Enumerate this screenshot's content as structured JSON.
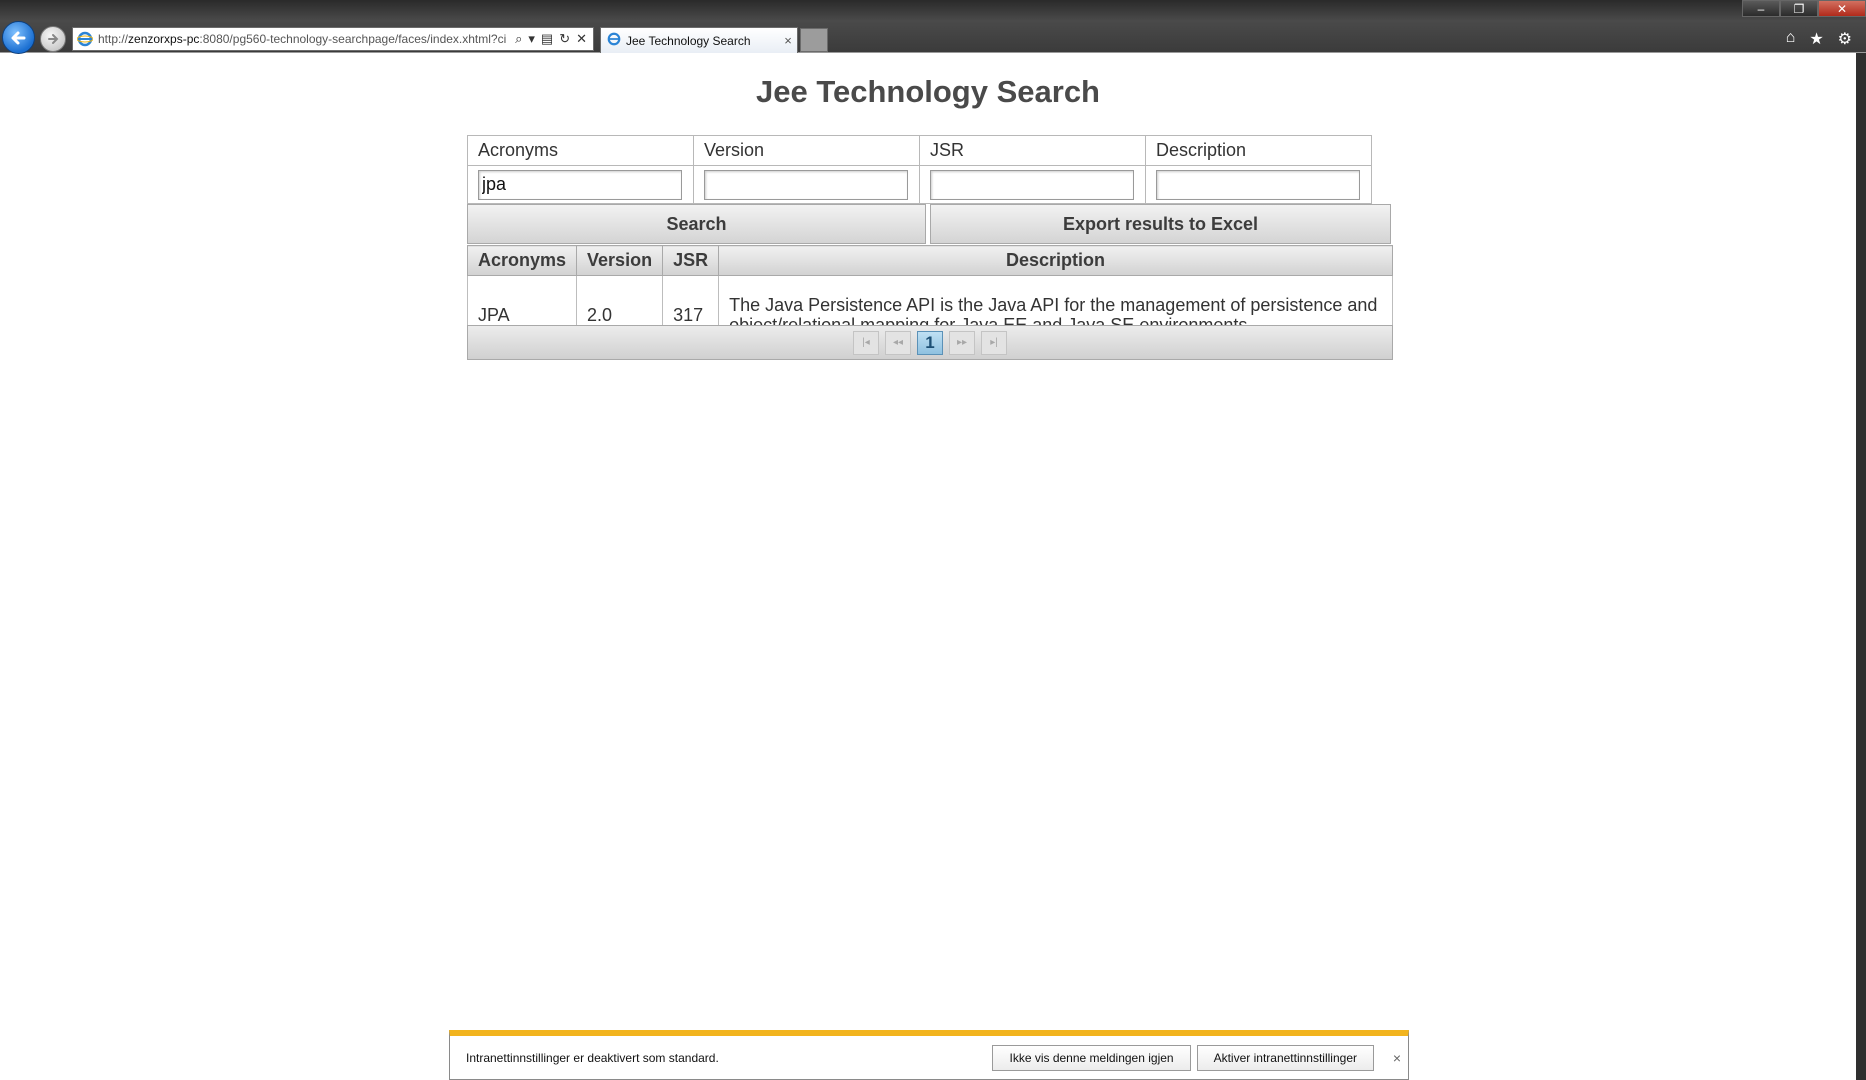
{
  "browser": {
    "url_prefix": "http://",
    "url_host": "zenzorxps-pc",
    "url_rest": ":8080/pg560-technology-searchpage/faces/index.xhtml?ci",
    "tab_title": "Jee Technology Search",
    "tab_close": "×",
    "window_buttons": {
      "minimize": "–",
      "restore": "❐",
      "close": "✕"
    }
  },
  "page": {
    "title": "Jee Technology Search"
  },
  "filters": {
    "labels": [
      "Acronyms",
      "Version",
      "JSR",
      "Description"
    ],
    "values": [
      "jpa",
      "",
      "",
      ""
    ]
  },
  "buttons": {
    "search": "Search",
    "export": "Export results to Excel"
  },
  "results": {
    "headers": [
      "Acronyms",
      "Version",
      "JSR",
      "Description"
    ],
    "rows": [
      {
        "acronym": "JPA",
        "version": "2.0",
        "jsr": "317",
        "description": "The Java Persistence API is the Java API for the management of persistence and object/relational mapping for Java EE and Java SE environments"
      }
    ]
  },
  "pager": {
    "first": "|◂",
    "prev": "◂◂",
    "current_page": "1",
    "next": "▸▸",
    "last": "▸|"
  },
  "infobar": {
    "message": "Intranettinnstillinger er deaktivert som standard.",
    "dont_show": "Ikke vis denne meldingen igjen",
    "enable": "Aktiver intranettinnstillinger",
    "close": "×"
  },
  "colors": {
    "title": "#4a4a4a",
    "infobar_accent": "#f2b41e",
    "pager_current": "#8fc1e0"
  }
}
